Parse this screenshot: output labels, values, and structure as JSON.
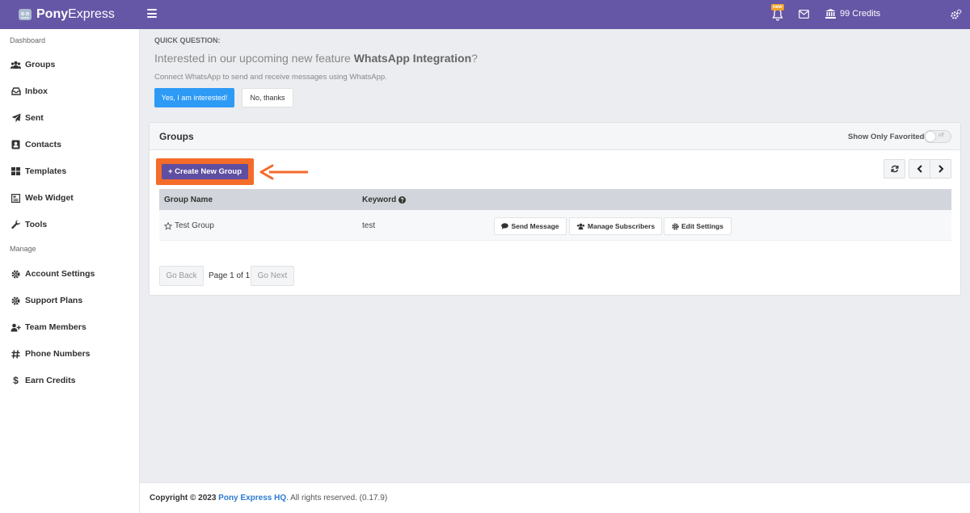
{
  "topbar": {
    "brand_bold": "Pony",
    "brand_light": "Express",
    "new_badge": "new",
    "credits": "99 Credits",
    "icons": [
      "pony-logo-icon",
      "hamburger-icon",
      "bell-icon",
      "mail-icon",
      "bank-icon",
      "gears-icon"
    ]
  },
  "sidebar": {
    "section_dashboard": "Dashboard",
    "section_manage": "Manage",
    "items": [
      {
        "label": "Groups",
        "icon": "users-icon"
      },
      {
        "label": "Inbox",
        "icon": "inbox-icon"
      },
      {
        "label": "Sent",
        "icon": "paper-plane-icon"
      },
      {
        "label": "Contacts",
        "icon": "address-book-icon"
      },
      {
        "label": "Templates",
        "icon": "grid-icon"
      },
      {
        "label": "Web Widget",
        "icon": "widget-icon"
      },
      {
        "label": "Tools",
        "icon": "wrench-icon"
      }
    ],
    "manage_items": [
      {
        "label": "Account Settings",
        "icon": "gear-icon"
      },
      {
        "label": "Support Plans",
        "icon": "gear-icon"
      },
      {
        "label": "Team Members",
        "icon": "user-plus-icon"
      },
      {
        "label": "Phone Numbers",
        "icon": "hash-icon"
      },
      {
        "label": "Earn Credits",
        "icon": "dollar-icon"
      }
    ]
  },
  "quick_question": {
    "label": "QUICK QUESTION:",
    "title_prefix": "Interested in our upcoming new feature ",
    "title_bold": "WhatsApp Integration",
    "title_suffix": "?",
    "subtitle": "Connect WhatsApp to send and receive messages using WhatsApp.",
    "yes_label": "Yes, I am interested!",
    "no_label": "No, thanks"
  },
  "groups_panel": {
    "title": "Groups",
    "favorited_label": "Show Only Favorited",
    "toggle_state": "off",
    "create_label": "+ Create New Group",
    "highlight_color": "#f56b2a",
    "columns": [
      "Group Name",
      "Keyword"
    ],
    "rows": [
      {
        "name": "Test Group",
        "keyword": "test"
      }
    ],
    "actions": [
      "Send Message",
      "Manage Subscribers",
      "Edit Settings"
    ],
    "pager": {
      "back": "Go Back",
      "page": "Page 1 of 1",
      "next": "Go Next"
    }
  },
  "footer": {
    "prefix": "Copyright © 2023 ",
    "link": "Pony Express HQ",
    "suffix": ". All rights reserved. (0.17.9)"
  },
  "colors": {
    "brand": "#6556a6",
    "primary_button": "#2d9af5",
    "create_button": "#5e4fa2"
  }
}
